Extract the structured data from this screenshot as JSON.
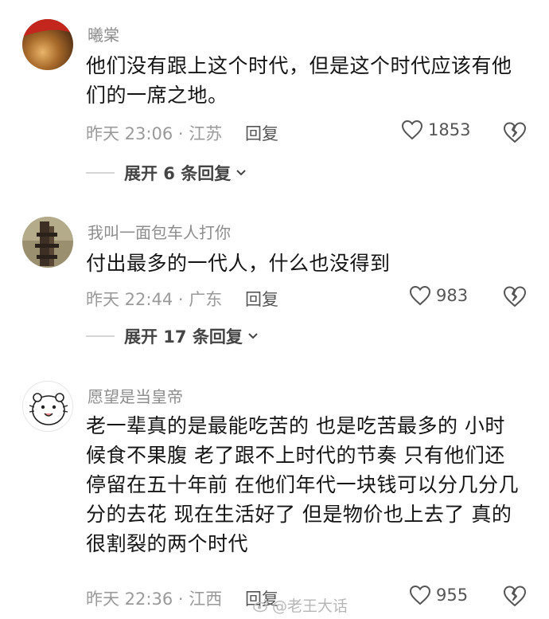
{
  "comments": [
    {
      "username": "曦棠",
      "text_lines": [
        "他们没有跟上这个时代，但是这个时代应该有他",
        "们的一席之地。"
      ],
      "meta": "昨天 23:06 · 江苏",
      "reply_label": "回复",
      "likes": "1853",
      "expand_label": "展开 6 条回复"
    },
    {
      "username": "我叫一面包车人打你",
      "text_lines": [
        "付出最多的一代人，什么也没得到"
      ],
      "meta": "昨天 22:44 · 广东",
      "reply_label": "回复",
      "likes": "983",
      "expand_label": "展开 17 条回复"
    },
    {
      "username": "愿望是当皇帝",
      "text_lines": [
        "老一辈真的是最能吃苦的 也是吃苦最多的 小时",
        "候食不果腹 老了跟不上时代的节奏 只有他们还",
        "停留在五十年前 在他们年代一块钱可以分几分几",
        "分的去花 现在生活好了 但是物价也上去了 真的",
        "很割裂的两个时代"
      ],
      "meta": "昨天 22:36 · 江西",
      "reply_label": "回复",
      "likes": "955"
    }
  ],
  "watermark": "@老王大话",
  "colors": {
    "text": "#151515",
    "muted": "#9a9a9a",
    "username": "#8d8d8d"
  },
  "icons": [
    "heart-outline-icon",
    "broken-heart-icon",
    "chevron-down-icon",
    "weibo-logo-icon"
  ]
}
